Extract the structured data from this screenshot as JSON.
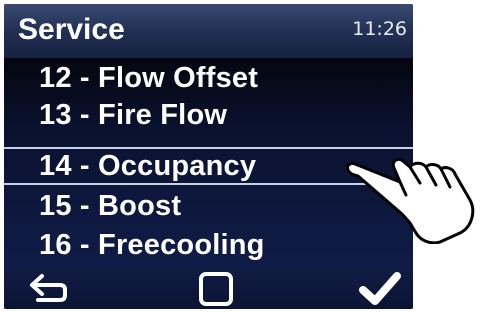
{
  "header": {
    "title": "Service",
    "time": "11:26"
  },
  "menu": {
    "items": [
      {
        "label": "12 - Flow Offset",
        "selected": false
      },
      {
        "label": "13 - Fire Flow",
        "selected": false
      },
      {
        "label": "14 - Occupancy",
        "selected": true
      },
      {
        "label": "15 - Boost",
        "selected": false
      },
      {
        "label": "16 - Freecooling",
        "selected": false
      }
    ]
  },
  "footer": {
    "back_icon": "back-arrow-icon",
    "home_icon": "square-icon",
    "confirm_icon": "checkmark-icon"
  },
  "colors": {
    "header_bg": "#243257",
    "list_bg": "#0a1230",
    "text": "#ffffff",
    "selection_line": "#c9d1e6"
  },
  "annotation": {
    "icon": "pointing-hand-icon"
  }
}
